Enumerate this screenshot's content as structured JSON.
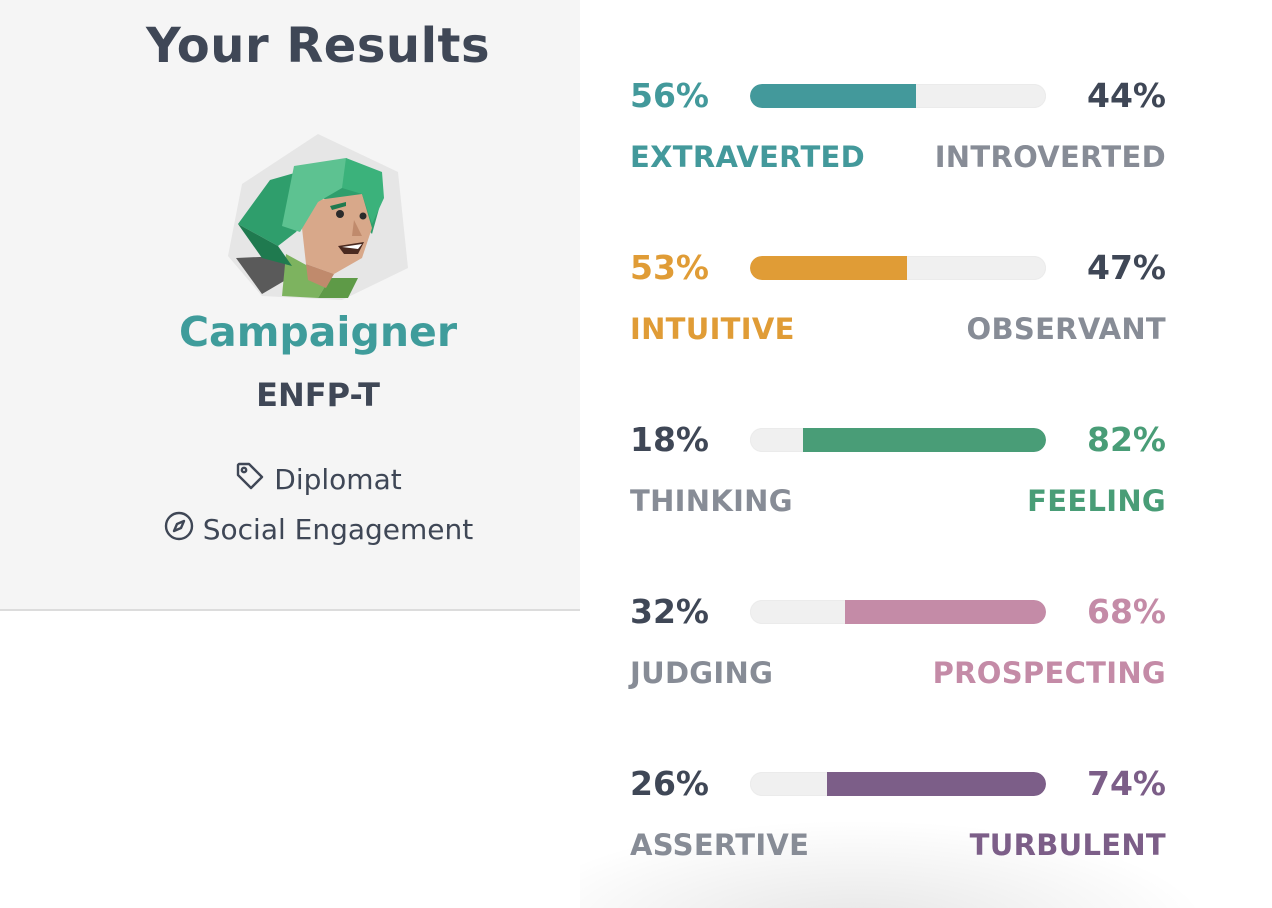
{
  "left": {
    "title": "Your Results",
    "type_name": "Campaigner",
    "type_code": "ENFP-T",
    "role": "Diplomat",
    "strategy": "Social Engagement",
    "accent": "#3f9c9b"
  },
  "traits": [
    {
      "left_pct": "56%",
      "right_pct": "44%",
      "left_label": "EXTRAVERTED",
      "right_label": "INTROVERTED",
      "dominant": "left",
      "fill_fraction": 0.56,
      "color": "#43999b"
    },
    {
      "left_pct": "53%",
      "right_pct": "47%",
      "left_label": "INTUITIVE",
      "right_label": "OBSERVANT",
      "dominant": "left",
      "fill_fraction": 0.53,
      "color": "#e09c36"
    },
    {
      "left_pct": "18%",
      "right_pct": "82%",
      "left_label": "THINKING",
      "right_label": "FEELING",
      "dominant": "right",
      "fill_fraction": 0.82,
      "color": "#499d77"
    },
    {
      "left_pct": "32%",
      "right_pct": "68%",
      "left_label": "JUDGING",
      "right_label": "PROSPECTING",
      "dominant": "right",
      "fill_fraction": 0.68,
      "color": "#c48ba7"
    },
    {
      "left_pct": "26%",
      "right_pct": "74%",
      "left_label": "ASSERTIVE",
      "right_label": "TURBULENT",
      "dominant": "right",
      "fill_fraction": 0.74,
      "color": "#7c5e88"
    }
  ],
  "colors": {
    "text_dark": "#3f4756",
    "text_muted": "#878c96",
    "bar_track": "#f0f0f0"
  },
  "icons": {
    "role": "tag-icon",
    "strategy": "compass-icon",
    "avatar": "campaigner-avatar"
  }
}
